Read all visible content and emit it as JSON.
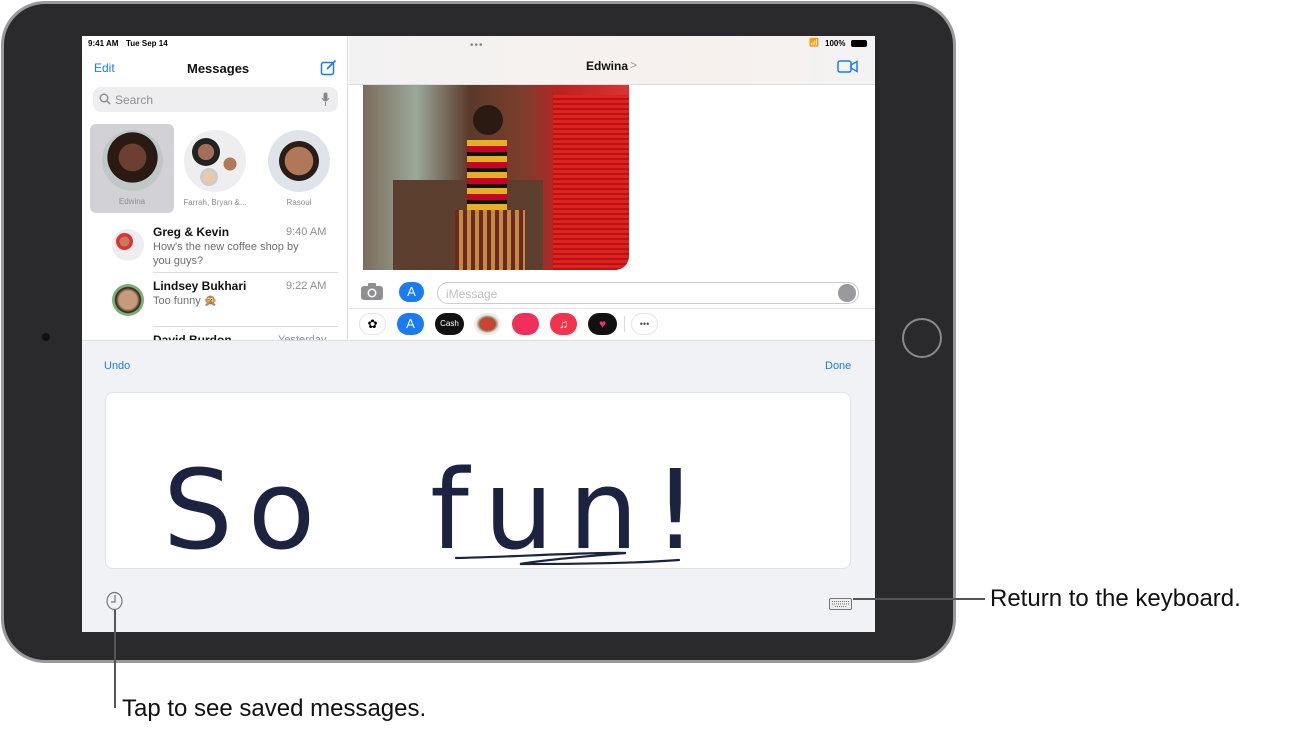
{
  "status": {
    "time": "9:41 AM",
    "date": "Tue Sep 14",
    "battery": "100%"
  },
  "sidebar": {
    "edit": "Edit",
    "title": "Messages",
    "search_placeholder": "Search",
    "pinned": [
      {
        "name": "Edwina"
      },
      {
        "name": "Farrah, Bryan &..."
      },
      {
        "name": "Rasoul"
      }
    ],
    "conversations": [
      {
        "name": "Greg & Kevin",
        "time": "9:40 AM",
        "preview": "How's the new coffee shop by you guys?"
      },
      {
        "name": "Lindsey Bukhari",
        "time": "9:22 AM",
        "preview": "Too funny 🙊"
      },
      {
        "name": "David Burdon",
        "time": "Yesterday",
        "preview": ""
      }
    ]
  },
  "chat": {
    "contact": "Edwina",
    "chevron": ">",
    "input_placeholder": "iMessage",
    "apps": [
      "photos",
      "app-store",
      "Cash",
      "memoji",
      "images-search",
      "music",
      "digital-touch",
      "more"
    ],
    "cash_label": "Cash",
    "more_label": "•••"
  },
  "handwriting": {
    "undo": "Undo",
    "done": "Done",
    "text": "So fun!"
  },
  "callouts": {
    "keyboard": "Return to the keyboard.",
    "saved": "Tap to see saved messages."
  },
  "colors": {
    "accent": "#1a7cf5",
    "ink": "#1c2340"
  }
}
